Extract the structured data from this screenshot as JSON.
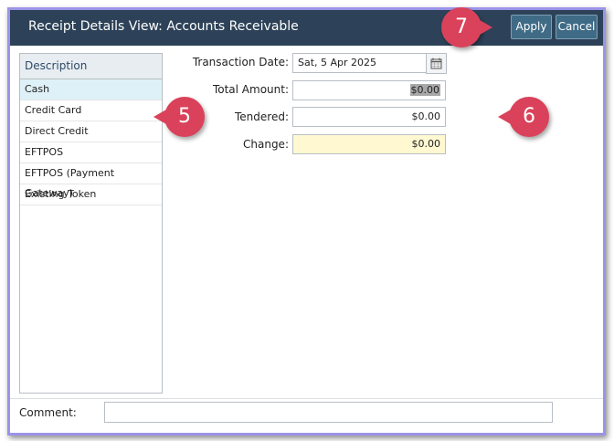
{
  "window": {
    "title": "Receipt Details View: Accounts Receivable"
  },
  "toolbar": {
    "apply_label": "Apply",
    "cancel_label": "Cancel"
  },
  "payment_list": {
    "header": "Description",
    "items": [
      {
        "label": "Cash"
      },
      {
        "label": "Credit Card"
      },
      {
        "label": "Direct Credit"
      },
      {
        "label": "EFTPOS"
      },
      {
        "label": "EFTPOS (Payment Gateway)"
      },
      {
        "label": "Existing Token"
      }
    ],
    "selected": "Cash"
  },
  "form": {
    "transaction_date_label": "Transaction Date:",
    "transaction_date_value": "Sat, 5 Apr 2025",
    "total_amount_label": "Total Amount:",
    "total_amount_value": "$0.00",
    "tendered_label": "Tendered:",
    "tendered_value": "$0.00",
    "change_label": "Change:",
    "change_value": "$0.00"
  },
  "comment": {
    "label": "Comment:",
    "value": ""
  },
  "callouts": {
    "five": "5",
    "six": "6",
    "seven": "7"
  },
  "colors": {
    "titlebar": "#2d4258",
    "button": "#3f6b86",
    "callout": "#d9425a",
    "change_field": "#fff8d1",
    "selected_row": "#dff1f8"
  }
}
